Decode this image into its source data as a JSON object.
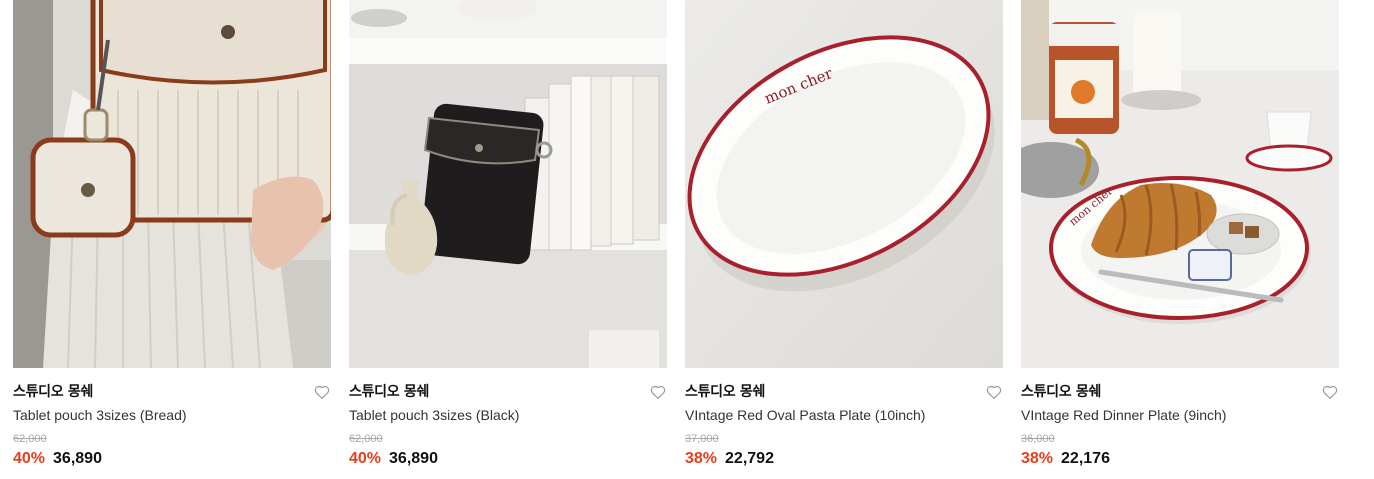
{
  "products": [
    {
      "brand": "스튜디오 몽쉐",
      "name": "Tablet pouch 3sizes (Bread)",
      "original_price": "62,000",
      "discount": "40%",
      "price": "36,890",
      "image_icon": "tablet-pouch-bread-photo"
    },
    {
      "brand": "스튜디오 몽쉐",
      "name": "Tablet pouch 3sizes (Black)",
      "original_price": "62,000",
      "discount": "40%",
      "price": "36,890",
      "image_icon": "tablet-pouch-black-photo"
    },
    {
      "brand": "스튜디오 몽쉐",
      "name": "VIntage Red Oval Pasta Plate (10inch)",
      "original_price": "37,000",
      "discount": "38%",
      "price": "22,792",
      "image_icon": "oval-plate-photo"
    },
    {
      "brand": "스튜디오 몽쉐",
      "name": "VIntage Red Dinner Plate (9inch)",
      "original_price": "36,000",
      "discount": "38%",
      "price": "22,176",
      "image_icon": "dinner-plate-photo"
    }
  ],
  "plate_text": "mon cher",
  "colors": {
    "discount": "#e8401c",
    "plate_rim": "#a8202c",
    "brand_text": "#111111"
  }
}
